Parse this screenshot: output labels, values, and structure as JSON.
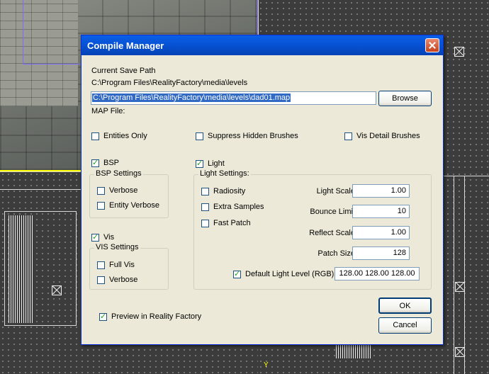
{
  "dialog": {
    "title": "Compile Manager",
    "current_save_path_label": "Current Save Path",
    "current_save_path_value": "C:\\Program Files\\RealityFactory\\media\\levels",
    "map_path_value": "C:\\Program Files\\RealityFactory\\media\\levels\\dad01.map",
    "browse_label": "Browse",
    "map_file_label": "MAP File:",
    "options": {
      "entities_only": {
        "label": "Entities Only",
        "checked": false
      },
      "suppress_hidden_brushes": {
        "label": "Suppress Hidden Brushes",
        "checked": false
      },
      "vis_detail_brushes": {
        "label": "Vis Detail Brushes",
        "checked": false
      }
    },
    "bsp": {
      "label": "BSP",
      "checked": true,
      "group_label": "BSP Settings",
      "verbose": {
        "label": "Verbose",
        "checked": false
      },
      "entity_verbose": {
        "label": "Entity Verbose",
        "checked": false
      }
    },
    "vis": {
      "label": "Vis",
      "checked": true,
      "group_label": "VIS Settings",
      "full_vis": {
        "label": "Full Vis",
        "checked": false
      },
      "verbose": {
        "label": "Verbose",
        "checked": false
      }
    },
    "light": {
      "label": "Light",
      "checked": true,
      "group_label": "Light Settings:",
      "radiosity": {
        "label": "Radiosity",
        "checked": false
      },
      "extra_samples": {
        "label": "Extra Samples",
        "checked": false
      },
      "fast_patch": {
        "label": "Fast Patch",
        "checked": false
      },
      "light_scale": {
        "label": "Light Scale",
        "value": "1.00"
      },
      "bounce_limit": {
        "label": "Bounce Limit",
        "value": "10"
      },
      "reflect_scale": {
        "label": "Reflect Scale",
        "value": "1.00"
      },
      "patch_size": {
        "label": "Patch Size",
        "value": "128"
      },
      "default_light_level": {
        "label": "Default Light Level (RGB)",
        "checked": true,
        "value": "128.00 128.00 128.00"
      }
    },
    "preview": {
      "label": "Preview in Reality Factory",
      "checked": true
    },
    "ok_label": "OK",
    "cancel_label": "Cancel"
  },
  "background": {
    "axis_label": "Y"
  }
}
